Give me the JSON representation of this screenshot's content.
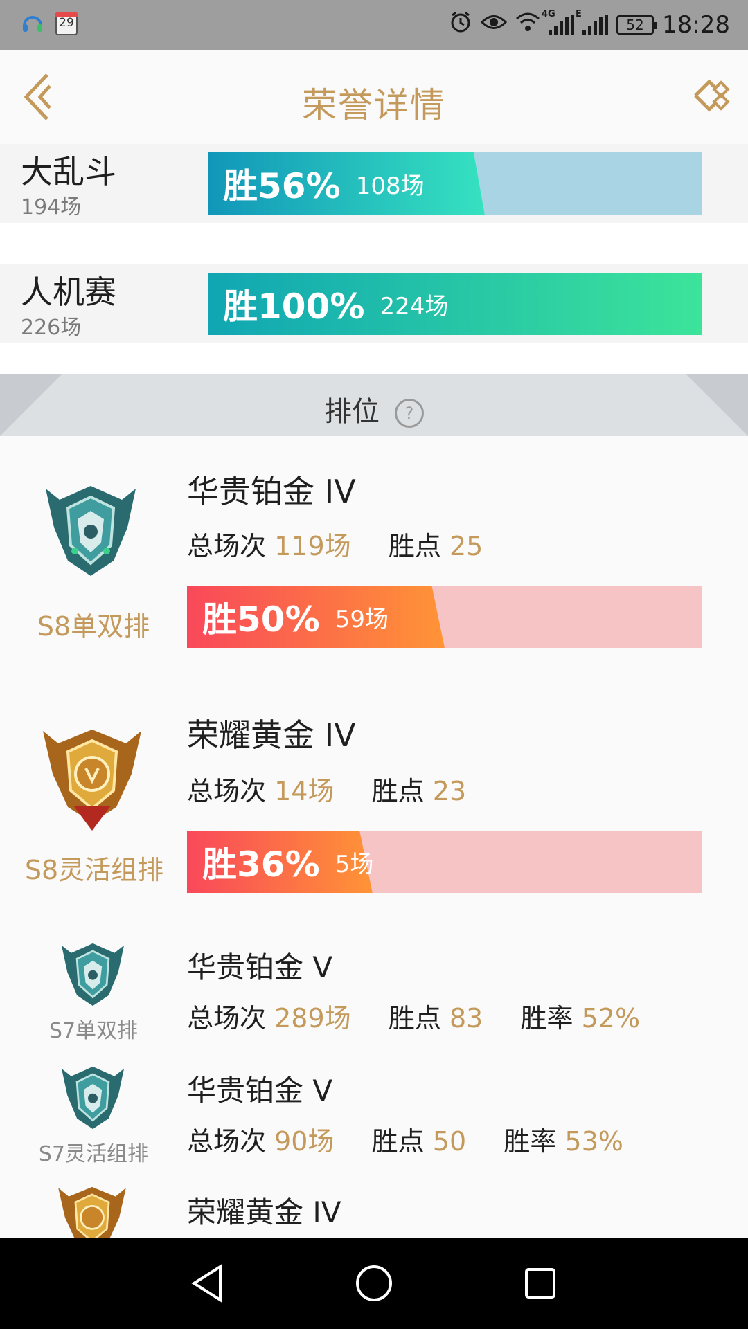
{
  "status_bar": {
    "calendar_day": "29",
    "network_4g": "4G",
    "network_e": "E",
    "battery": "52",
    "time": "18:28",
    "icons": [
      "headset-app-icon",
      "calendar-icon",
      "alarm-icon",
      "eye-icon",
      "wifi-icon",
      "signal-icon",
      "battery-icon"
    ]
  },
  "header": {
    "title": "荣誉详情",
    "back_icon": "chevron-left-icon",
    "share_icon": "share-icon"
  },
  "modes": [
    {
      "name": "大乱斗",
      "total": "194场",
      "win_label": "胜56%",
      "wins": "108场",
      "win_rate": 0.56
    },
    {
      "name": "人机赛",
      "total": "226场",
      "win_label": "胜100%",
      "wins": "224场",
      "win_rate": 1.0
    }
  ],
  "ranked": {
    "title": "排位",
    "help_icon": "?",
    "seasons": [
      {
        "label": "S8单双排",
        "tier": "华贵铂金 IV",
        "games_label": "总场次",
        "games": "119场",
        "points_label": "胜点",
        "points": "25",
        "win_label": "胜50%",
        "wins": "59场",
        "win_rate": 0.5,
        "emblem": "platinum-emblem-icon"
      },
      {
        "label": "S8灵活组排",
        "tier": "荣耀黄金 IV",
        "games_label": "总场次",
        "games": "14场",
        "points_label": "胜点",
        "points": "23",
        "win_label": "胜36%",
        "wins": "5场",
        "win_rate": 0.36,
        "emblem": "gold-emblem-icon"
      },
      {
        "label": "S7单双排",
        "tier": "华贵铂金 V",
        "games_label": "总场次",
        "games": "289场",
        "points_label": "胜点",
        "points": "83",
        "rate_label": "胜率",
        "rate": "52%",
        "emblem": "platinum-emblem-icon"
      },
      {
        "label": "S7灵活组排",
        "tier": "华贵铂金 V",
        "games_label": "总场次",
        "games": "90场",
        "points_label": "胜点",
        "points": "50",
        "rate_label": "胜率",
        "rate": "53%",
        "emblem": "platinum-emblem-icon"
      },
      {
        "label": "",
        "tier": "荣耀黄金 IV",
        "emblem": "gold-emblem-icon"
      }
    ]
  },
  "colors": {
    "accent_gold": "#c49a5c",
    "bar_blue_start": "#1196b9",
    "bar_blue_end": "#36e2c0",
    "bar_green_end": "#3ce49a",
    "bar_red_start": "#f9485a",
    "bar_orange_end": "#ff9436",
    "bar_pink_bg": "#f7c4c6",
    "bar_light_blue_bg": "#a9d4e4"
  },
  "nav_bar": {
    "icons": [
      "back-triangle-icon",
      "home-circle-icon",
      "recents-square-icon"
    ]
  }
}
